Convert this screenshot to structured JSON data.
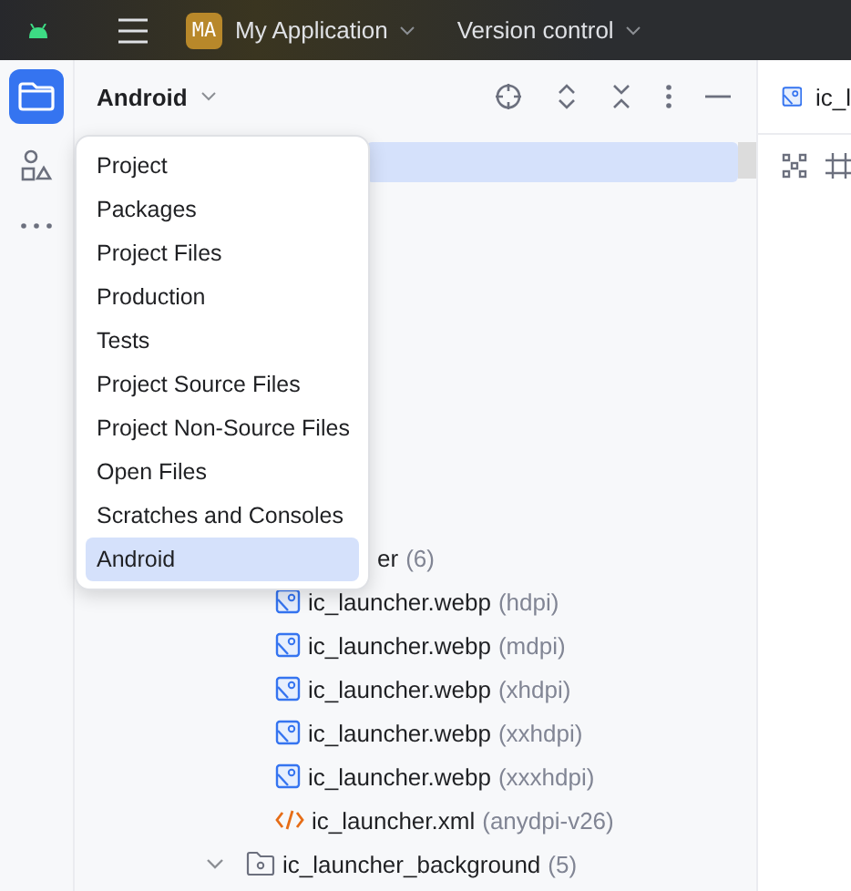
{
  "title_bar": {
    "project_badge": "MA",
    "project": "My Application",
    "vcs": "Version control"
  },
  "project_panel": {
    "view_selector": "Android",
    "rows": [
      {
        "kind": "cut",
        "name": "er",
        "detail": "(6)"
      },
      {
        "kind": "image",
        "name": "ic_launcher.webp",
        "detail": "(hdpi)"
      },
      {
        "kind": "image",
        "name": "ic_launcher.webp",
        "detail": "(mdpi)"
      },
      {
        "kind": "image",
        "name": "ic_launcher.webp",
        "detail": "(xhdpi)"
      },
      {
        "kind": "image",
        "name": "ic_launcher.webp",
        "detail": "(xxhdpi)"
      },
      {
        "kind": "image",
        "name": "ic_launcher.webp",
        "detail": "(xxxhdpi)"
      },
      {
        "kind": "xml",
        "name": "ic_launcher.xml",
        "detail": "(anydpi-v26)"
      },
      {
        "kind": "folder",
        "name": "ic_launcher_background",
        "detail": "(5)",
        "expanded": true
      }
    ]
  },
  "view_menu": [
    {
      "label": "Project",
      "selected": false
    },
    {
      "label": "Packages",
      "selected": false
    },
    {
      "label": "Project Files",
      "selected": false
    },
    {
      "label": "Production",
      "selected": false
    },
    {
      "label": "Tests",
      "selected": false
    },
    {
      "label": "Project Source Files",
      "selected": false
    },
    {
      "label": "Project Non-Source Files",
      "selected": false
    },
    {
      "label": "Open Files",
      "selected": false
    },
    {
      "label": "Scratches and Consoles",
      "selected": false
    },
    {
      "label": "Android",
      "selected": true
    }
  ],
  "editor": {
    "tab": "ic_l"
  }
}
